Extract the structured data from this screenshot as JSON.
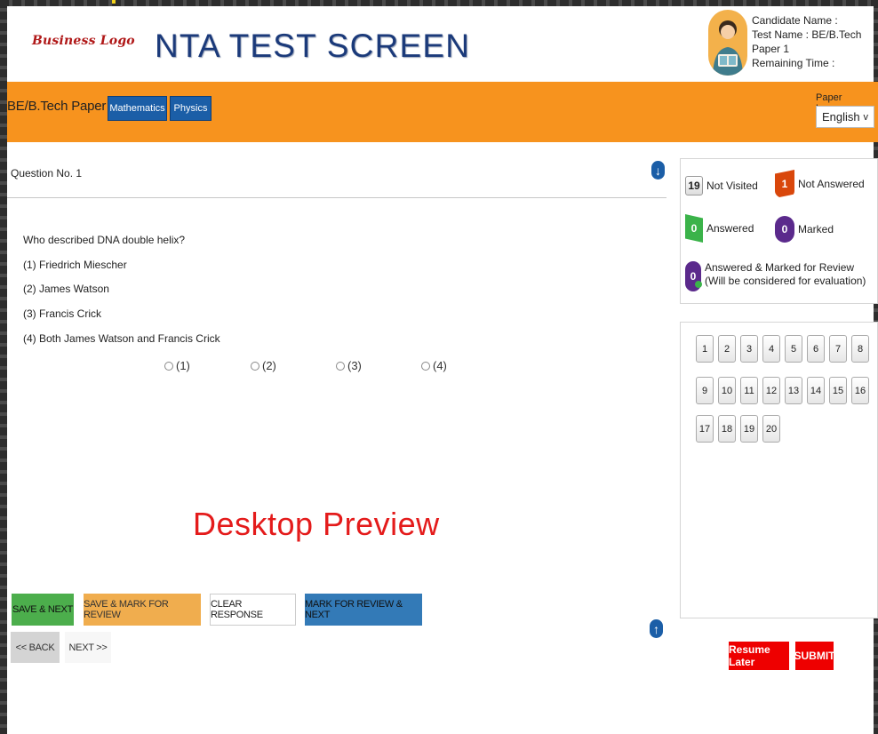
{
  "header": {
    "logo_text": "Business Logo",
    "title": "NTA TEST SCREEN",
    "candidate_name_label": "Candidate Name :",
    "test_name_label": "Test Name : BE/B.Tech Paper 1",
    "remaining_time_label": "Remaining Time :"
  },
  "subject_bar": {
    "paper_title": "BE/B.Tech Paper 1",
    "tabs": [
      {
        "label": "Mathematics"
      },
      {
        "label": "Physics"
      }
    ],
    "language_label": "Paper Language",
    "language_selected": "English"
  },
  "question": {
    "number_label": "Question No. 1",
    "text": "Who described DNA double helix?",
    "options": [
      "(1) Friedrich Miescher",
      "(2) James Watson",
      "(3) Francis Crick",
      "(4) Both James Watson and Francis Crick"
    ],
    "radio_labels": [
      "(1)",
      "(2)",
      "(3)",
      "(4)"
    ]
  },
  "watermark": "Desktop Preview",
  "actions": {
    "save_next": "SAVE & NEXT",
    "save_mark_review": "SAVE & MARK FOR REVIEW",
    "clear_response": "CLEAR RESPONSE",
    "mark_review_next": "MARK FOR REVIEW & NEXT",
    "back": "<< BACK",
    "next": "NEXT >>"
  },
  "legend": {
    "not_visited": {
      "count": "19",
      "label": "Not Visited"
    },
    "not_answered": {
      "count": "1",
      "label": "Not Answered"
    },
    "answered": {
      "count": "0",
      "label": "Answered"
    },
    "marked": {
      "count": "0",
      "label": "Marked"
    },
    "answered_marked": {
      "count": "0",
      "label": "Answered & Marked for Review (Will be considered for evaluation)"
    }
  },
  "palette": {
    "questions": [
      "1",
      "2",
      "3",
      "4",
      "5",
      "6",
      "7",
      "8",
      "9",
      "10",
      "11",
      "12",
      "13",
      "14",
      "15",
      "16",
      "17",
      "18",
      "19",
      "20"
    ]
  },
  "footer": {
    "resume_later": "Resume Later",
    "submit": "SUBMIT"
  },
  "colors": {
    "orange_bar": "#f7931e",
    "tab_blue": "#1b5ea7",
    "green": "#4cae4c",
    "red": "#ee0000",
    "purple": "#5b2a8c"
  },
  "icons": {
    "scroll_down": "arrow-down-icon",
    "scroll_up": "arrow-up-icon"
  }
}
